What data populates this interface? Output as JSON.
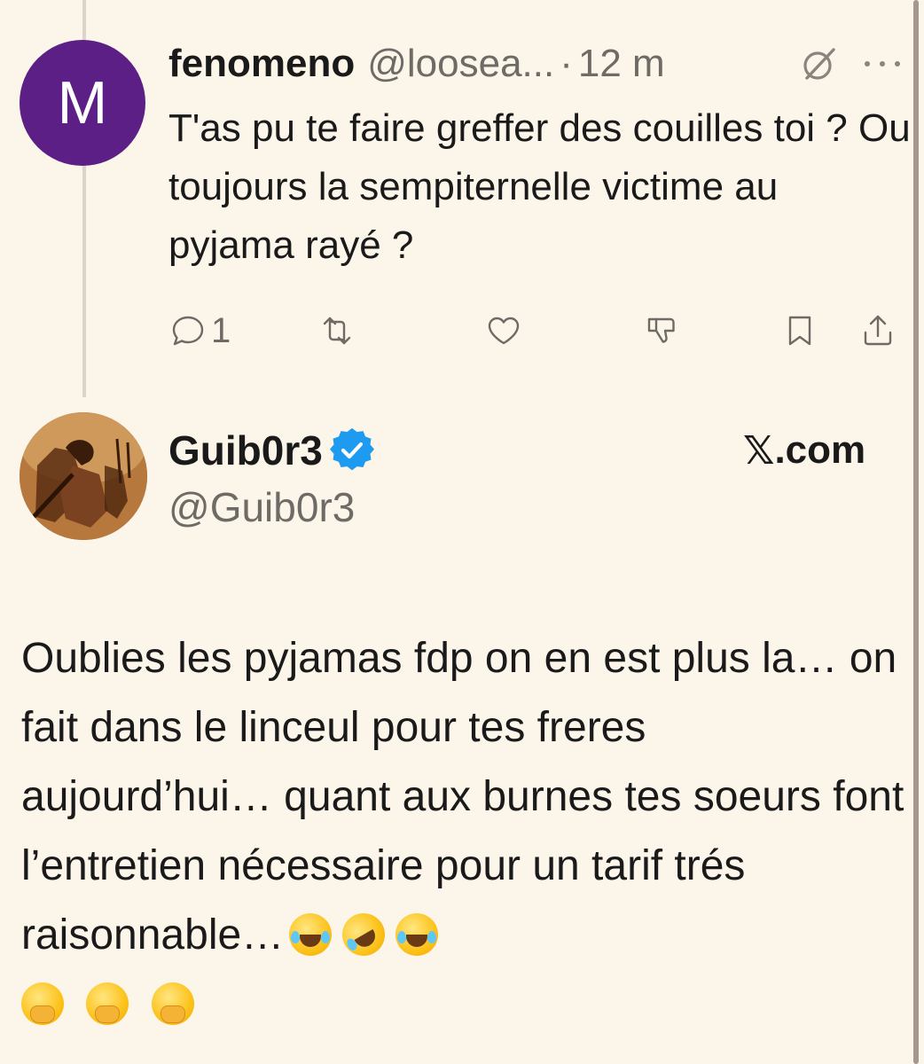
{
  "reply": {
    "avatar_letter": "M",
    "avatar_color": "#5c1f85",
    "display_name": "fenomeno",
    "handle": "@loosea...",
    "separator": "·",
    "time": "12 m",
    "text": "T'as pu te faire greffer des couilles toi ? Ou toujours la sempiternelle victime au pyjama rayé ?",
    "actions": {
      "reply_count": "1"
    }
  },
  "main": {
    "display_name": "Guib0r3",
    "handle": "@Guib0r3",
    "source_x": "𝕏",
    "source_domain": ".com",
    "verified_color": "#1d9bf0",
    "text": "Oublies les pyjamas fdp on en est plus la… on fait dans le linceul pour tes freres aujourd’hui… quant aux burnes tes soeurs font l’entretien nécessaire pour un tarif trés raisonnable…"
  },
  "icons": {
    "reply_icons": [
      "grok-icon",
      "more-icon",
      "reply-icon",
      "retweet-icon",
      "like-icon",
      "dislike-icon",
      "bookmark-icon",
      "share-icon"
    ],
    "emojis": [
      "face-with-tears-of-joy",
      "rolling-on-the-floor-laughing",
      "face-with-tears-of-joy",
      "face-with-hand-over-mouth",
      "face-with-hand-over-mouth",
      "face-with-hand-over-mouth"
    ]
  }
}
